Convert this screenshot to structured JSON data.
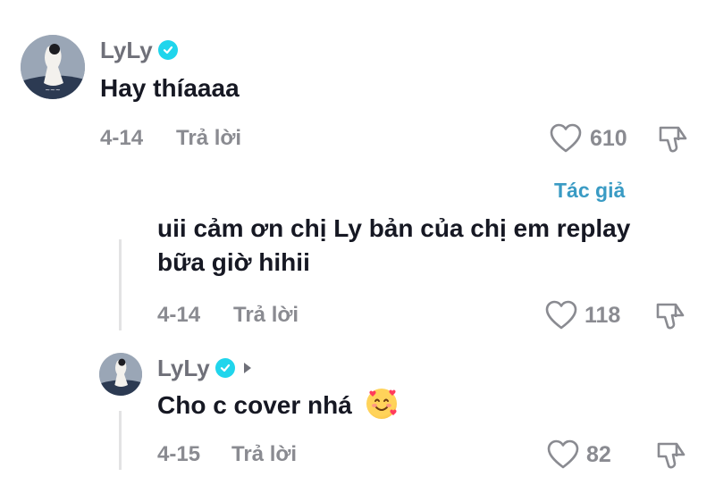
{
  "comments": [
    {
      "user": "LyLy",
      "text": "Hay thíaaaa",
      "date": "4-14",
      "reply_label": "Trả lời",
      "likes": "610"
    },
    {
      "author_tag": "Tác giả",
      "text": "uii cảm ơn chị Ly bản của chị em replay bữa giờ hihii",
      "date": "4-14",
      "reply_label": "Trả lời",
      "likes": "118"
    },
    {
      "user": "LyLy",
      "text": "Cho c cover nhá",
      "emoji": "smiling-face-with-hearts",
      "date": "4-15",
      "reply_label": "Trả lời",
      "likes": "82"
    }
  ],
  "colors": {
    "verified": "#20d5ec",
    "author_tag": "#3a9bc4",
    "meta": "#8a8b91"
  }
}
